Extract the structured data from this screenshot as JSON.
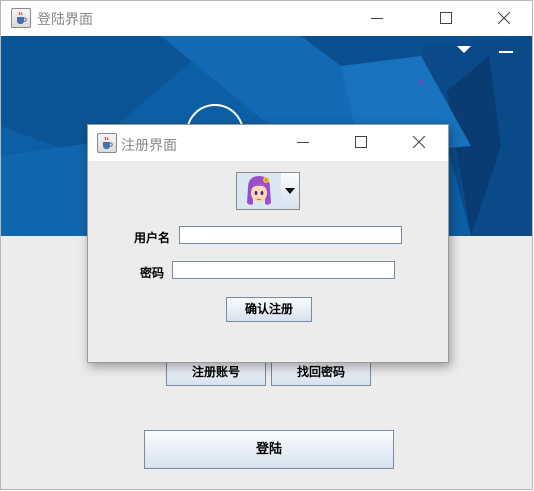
{
  "main_window": {
    "title": "登陆界面",
    "buttons": {
      "register_account": "注册账号",
      "find_password": "找回密码",
      "login": "登陆"
    }
  },
  "dialog": {
    "title": "注册界面",
    "username_label": "用户名",
    "username_value": "",
    "password_label": "密码",
    "password_value": "",
    "confirm_button": "确认注册",
    "avatar_selector": {
      "selected": "girl-avatar-icon"
    }
  },
  "colors": {
    "banner": "#0d5fa5",
    "window_bg": "#ececec",
    "button_gradient_bottom": "#d6e1ee"
  }
}
